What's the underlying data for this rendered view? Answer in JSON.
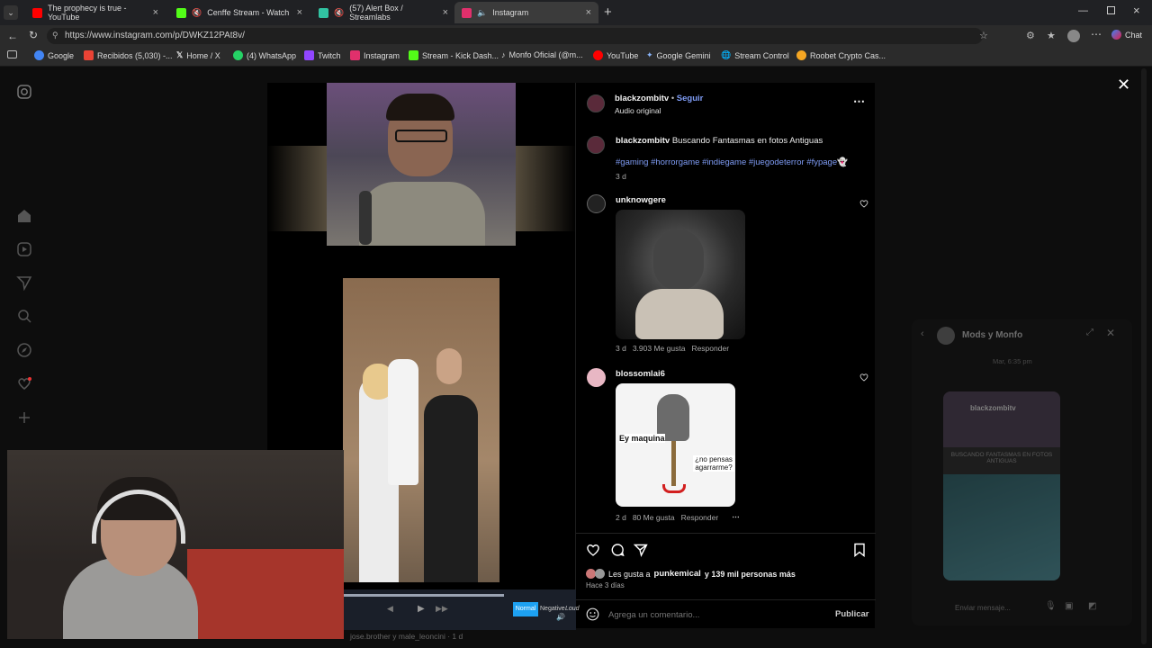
{
  "browser": {
    "tabs": [
      {
        "label": "The prophecy is true - YouTube",
        "color": "#ff0000"
      },
      {
        "label": "Cenffe Stream - Watch Live o",
        "color": "#53fc18"
      },
      {
        "label": "(57) Alert Box / Streamlabs",
        "color": "#31c3a2"
      },
      {
        "label": "Instagram",
        "color": "#e1306c"
      }
    ],
    "url": "https://www.instagram.com/p/DWKZ12PAt8v/",
    "chat_label": "Chat",
    "bookmarks": [
      {
        "label": "Google",
        "color": "#4285f4"
      },
      {
        "label": "Recibidos (5,030) -...",
        "color": "#ea4335"
      },
      {
        "label": "Home / X",
        "color": "#ffffff"
      },
      {
        "label": "(4) WhatsApp",
        "color": "#25d366"
      },
      {
        "label": "Twitch",
        "color": "#9146ff"
      },
      {
        "label": "Instagram",
        "color": "#e1306c"
      },
      {
        "label": "Stream - Kick Dash...",
        "color": "#53fc18"
      },
      {
        "label": "Monfo Oficial (@m...",
        "color": "#ffffff"
      },
      {
        "label": "YouTube",
        "color": "#ff0000"
      },
      {
        "label": "Google Gemini",
        "color": "#8ab4f8"
      },
      {
        "label": "Stream Control",
        "color": "#cccccc"
      },
      {
        "label": "Roobet Crypto Cas...",
        "color": "#f5a623"
      }
    ]
  },
  "post": {
    "author": "blackzombitv",
    "follow_label": "Seguir",
    "audio": "Audio original",
    "caption_text": "Buscando Fantasmas en fotos Antiguas",
    "hashtags": "#gaming #horrorgame #indiegame #juegodeterror #fypage👻",
    "caption_age": "3 d",
    "likes_text": "Les gusta a",
    "likes_user": "punkemical",
    "likes_more": "y 139 mil personas más",
    "date": "Hace 3 días",
    "comment_placeholder": "Agrega un comentario...",
    "publish_label": "Publicar"
  },
  "comments": [
    {
      "user": "unknowgere",
      "age": "3 d",
      "likes": "3.903 Me gusta",
      "reply": "Responder"
    },
    {
      "user": "blossomlai6",
      "age": "2 d",
      "likes": "80 Me gusta",
      "reply": "Responder",
      "sticker_top": "Ey maquina",
      "sticker_bottom": "¿no pensas agarrarme?"
    }
  ],
  "chat": {
    "title": "Mods y Monfo",
    "time": "Mar, 6:35 pm",
    "preview_user": "blackzombitv",
    "preview_caption": "BUSCANDO FANTASMAS EN FOTOS ANTIGUAS",
    "input_placeholder": "Enviar mensaje..."
  },
  "player": {
    "modes": [
      "Normal",
      "Negative",
      "Loud"
    ],
    "footer": "jose.brother y male_leoncini · 1 d"
  }
}
